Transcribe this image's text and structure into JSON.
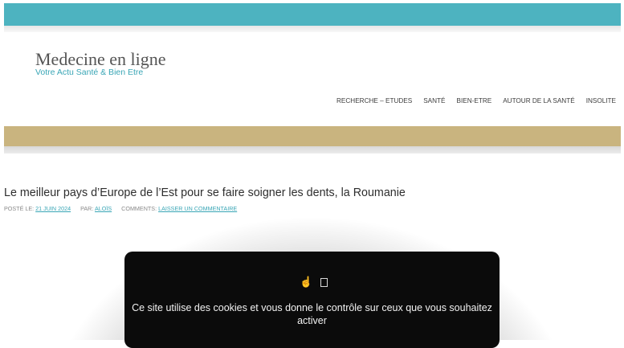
{
  "site": {
    "title": "Medecine en ligne",
    "tagline": "Votre Actu Santé & Bien Etre"
  },
  "nav": {
    "items": [
      {
        "label": "RECHERCHE – ETUDES"
      },
      {
        "label": "SANTÉ"
      },
      {
        "label": "BIEN-ETRE"
      },
      {
        "label": "AUTOUR DE LA SANTÉ"
      },
      {
        "label": "INSOLITE"
      }
    ]
  },
  "article": {
    "title": "Le meilleur pays d’Europe de l’Est pour se faire soigner les dents, la Roumanie",
    "posted_label": "POSTÉ LE:",
    "date": "21 JUIN 2024",
    "by_label": "PAR:",
    "author": "ALOÏS",
    "comments_label": "COMMENTS:",
    "comments_link": "LAISSER UN COMMENTAIRE"
  },
  "cookie": {
    "message": "Ce site utilise des cookies et vous donne le contrôle sur ceux que vous souhaitez activer",
    "icons": [
      "hand-pointer-icon",
      "square-icon"
    ]
  },
  "colors": {
    "accent": "#4db3c0",
    "gold": "#c9b47f",
    "link": "#3aa6b6",
    "cookie_bg": "#0b0b0b"
  }
}
